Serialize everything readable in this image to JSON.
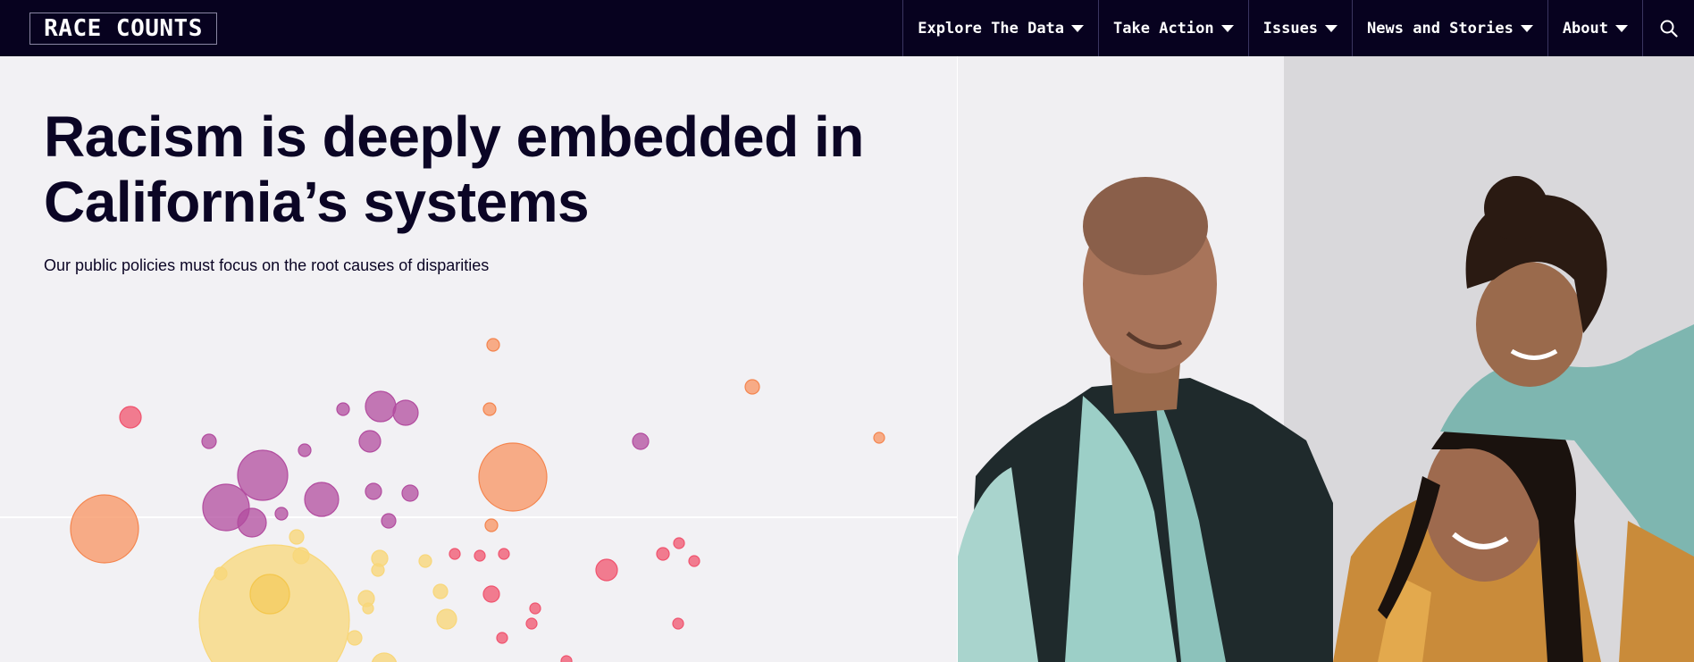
{
  "nav": {
    "logo": "RACE COUNTS",
    "items": [
      {
        "label": "Explore The Data"
      },
      {
        "label": "Take Action"
      },
      {
        "label": "Issues"
      },
      {
        "label": "News and Stories"
      },
      {
        "label": "About"
      }
    ],
    "search_icon": "search-icon"
  },
  "hero": {
    "headline_line1": "Racism is deeply embedded in",
    "headline_line2": "California’s systems",
    "subtext": "Our public policies must focus on the root causes of disparities"
  },
  "colors": {
    "nav_bg": "#07021f",
    "hero_bg": "#f2f1f4",
    "text": "#0b0525",
    "bubble_pink": "#f0536e",
    "bubble_purple": "#b24c9f",
    "bubble_orange": "#f79a6a",
    "bubble_yellow": "#f8d77a"
  }
}
